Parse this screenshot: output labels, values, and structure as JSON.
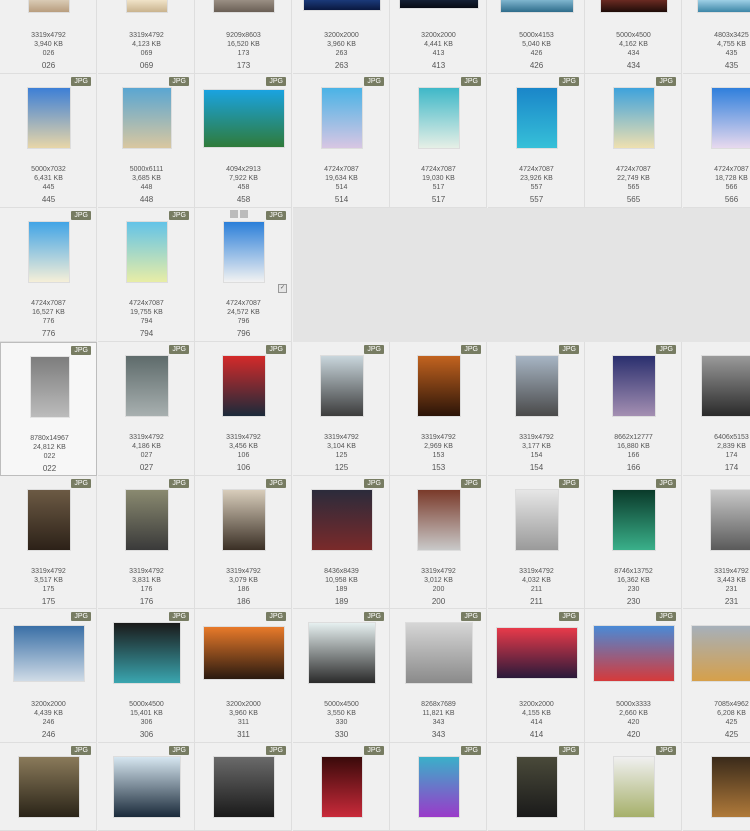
{
  "rows": [
    {
      "row": 0,
      "cells": [
        {
          "dim": "3319x4792",
          "size": "3,940 KB",
          "num": "026",
          "label": "026",
          "badge": "",
          "thumb": [
            "#d9cbb5",
            "#b89d7e"
          ]
        },
        {
          "dim": "3319x4792",
          "size": "4,123 KB",
          "num": "069",
          "label": "069",
          "badge": "",
          "thumb": [
            "#f0e3c8",
            "#c9b38e"
          ]
        },
        {
          "dim": "9209x8603",
          "size": "16,520 KB",
          "num": "173",
          "label": "173",
          "badge": "",
          "thumb": [
            "#9a8f84",
            "#6a5f55"
          ]
        },
        {
          "dim": "3200x2000",
          "size": "3,960 KB",
          "num": "263",
          "label": "263",
          "badge": "",
          "thumb": [
            "#1b3a7a",
            "#0a1840"
          ]
        },
        {
          "dim": "3200x2000",
          "size": "4,441 KB",
          "num": "413",
          "label": "413",
          "badge": "",
          "thumb": [
            "#152035",
            "#070b14"
          ]
        },
        {
          "dim": "5000x4153",
          "size": "5,040 KB",
          "num": "426",
          "label": "426",
          "badge": "",
          "thumb": [
            "#7fb6cf",
            "#2e6c8b"
          ]
        },
        {
          "dim": "5000x4500",
          "size": "4,162 KB",
          "num": "434",
          "label": "434",
          "badge": "",
          "thumb": [
            "#6a2a22",
            "#1f0c08"
          ]
        },
        {
          "dim": "4803x3425",
          "size": "4,755 KB",
          "num": "435",
          "label": "435",
          "badge": "",
          "thumb": [
            "#9ed0e6",
            "#3d86a7"
          ]
        }
      ]
    },
    {
      "row": 1,
      "cells": [
        {
          "dim": "5000x7032",
          "size": "6,431 KB",
          "num": "445",
          "label": "445",
          "badge": "JPG",
          "thumb": [
            "#3d7fd6",
            "#e8d6a8"
          ]
        },
        {
          "dim": "5000x6111",
          "size": "3,685 KB",
          "num": "448",
          "label": "448",
          "badge": "JPG",
          "thumb": [
            "#5aa6d2",
            "#d9c7a0"
          ]
        },
        {
          "dim": "4094x2913",
          "size": "7,922 KB",
          "num": "458",
          "label": "458",
          "badge": "JPG",
          "thumb": [
            "#1aa3e0",
            "#2f7b3a"
          ]
        },
        {
          "dim": "4724x7087",
          "size": "19,634 KB",
          "num": "514",
          "label": "514",
          "badge": "JPG",
          "thumb": [
            "#4ab3e6",
            "#d8c6e3"
          ]
        },
        {
          "dim": "4724x7087",
          "size": "19,030 KB",
          "num": "517",
          "label": "517",
          "badge": "JPG",
          "thumb": [
            "#3fb8c8",
            "#e6efe6"
          ]
        },
        {
          "dim": "4724x7087",
          "size": "23,926 KB",
          "num": "557",
          "label": "557",
          "badge": "JPG",
          "thumb": [
            "#1a86c9",
            "#36c0d8"
          ]
        },
        {
          "dim": "4724x7087",
          "size": "22,749 KB",
          "num": "565",
          "label": "565",
          "badge": "JPG",
          "thumb": [
            "#3ea2dc",
            "#efe0b0"
          ]
        },
        {
          "dim": "4724x7087",
          "size": "18,728 KB",
          "num": "566",
          "label": "566",
          "badge": "JPG",
          "thumb": [
            "#2f7fdc",
            "#e8d9ee"
          ]
        }
      ]
    },
    {
      "row": 2,
      "cells": [
        {
          "dim": "4724x7087",
          "size": "16,527 KB",
          "num": "776",
          "label": "776",
          "badge": "JPG",
          "thumb": [
            "#41a4e6",
            "#f6efd8"
          ]
        },
        {
          "dim": "4724x7087",
          "size": "19,755 KB",
          "num": "794",
          "label": "794",
          "badge": "JPG",
          "thumb": [
            "#63c3e8",
            "#e8eda6"
          ]
        },
        {
          "dim": "4724x7087",
          "size": "24,572 KB",
          "num": "796",
          "label": "796",
          "badge": "JPG",
          "thumb": [
            "#2b7fd9",
            "#f2f2f2"
          ]
        }
      ]
    },
    {
      "row": 3,
      "cells": [
        {
          "dim": "8780x14967",
          "size": "24,812 KB",
          "num": "022",
          "label": "022",
          "badge": "JPG",
          "thumb": [
            "#7d7d7d",
            "#bcbcbc"
          ]
        },
        {
          "dim": "3319x4792",
          "size": "4,186 KB",
          "num": "027",
          "label": "027",
          "badge": "JPG",
          "thumb": [
            "#5e6b6b",
            "#a8b0b0"
          ]
        },
        {
          "dim": "3319x4792",
          "size": "3,456 KB",
          "num": "106",
          "label": "106",
          "badge": "JPG",
          "thumb": [
            "#d42a2a",
            "#1b2a3a"
          ]
        },
        {
          "dim": "3319x4792",
          "size": "3,104 KB",
          "num": "125",
          "label": "125",
          "badge": "JPG",
          "thumb": [
            "#c9d6dc",
            "#3c3c3c"
          ]
        },
        {
          "dim": "3319x4792",
          "size": "2,969 KB",
          "num": "153",
          "label": "153",
          "badge": "JPG",
          "thumb": [
            "#c2631f",
            "#2b1408"
          ]
        },
        {
          "dim": "3319x4792",
          "size": "3,177 KB",
          "num": "154",
          "label": "154",
          "badge": "JPG",
          "thumb": [
            "#a7b5c4",
            "#4a4a4a"
          ]
        },
        {
          "dim": "8662x12777",
          "size": "16,880 KB",
          "num": "166",
          "label": "166",
          "badge": "JPG",
          "thumb": [
            "#2a2f6e",
            "#a48fb2"
          ]
        },
        {
          "dim": "6406x5153",
          "size": "2,839 KB",
          "num": "174",
          "label": "174",
          "badge": "JPG",
          "thumb": [
            "#9a9a9a",
            "#2a2a2a"
          ]
        }
      ]
    },
    {
      "row": 4,
      "cells": [
        {
          "dim": "3319x4792",
          "size": "3,517 KB",
          "num": "175",
          "label": "175",
          "badge": "JPG",
          "thumb": [
            "#6c5a44",
            "#2c2118"
          ]
        },
        {
          "dim": "3319x4792",
          "size": "3,831 KB",
          "num": "176",
          "label": "176",
          "badge": "JPG",
          "thumb": [
            "#8a8a70",
            "#3a3a3a"
          ]
        },
        {
          "dim": "3319x4792",
          "size": "3,079 KB",
          "num": "186",
          "label": "186",
          "badge": "JPG",
          "thumb": [
            "#d8cdbb",
            "#3a2f25"
          ]
        },
        {
          "dim": "8436x8439",
          "size": "10,958 KB",
          "num": "189",
          "label": "189",
          "badge": "JPG",
          "thumb": [
            "#2b2b3b",
            "#7a2a2a"
          ]
        },
        {
          "dim": "3319x4792",
          "size": "3,012 KB",
          "num": "200",
          "label": "200",
          "badge": "JPG",
          "thumb": [
            "#7a3a2a",
            "#c9c9c9"
          ]
        },
        {
          "dim": "3319x4792",
          "size": "4,032 KB",
          "num": "211",
          "label": "211",
          "badge": "JPG",
          "thumb": [
            "#e6e6e6",
            "#9a9a9a"
          ]
        },
        {
          "dim": "8746x13752",
          "size": "16,362 KB",
          "num": "230",
          "label": "230",
          "badge": "JPG",
          "thumb": [
            "#0a3a2a",
            "#3ab08a"
          ]
        },
        {
          "dim": "3319x4792",
          "size": "3,443 KB",
          "num": "231",
          "label": "231",
          "badge": "JPG",
          "thumb": [
            "#c8c8c8",
            "#5a5a5a"
          ]
        }
      ]
    },
    {
      "row": 5,
      "cells": [
        {
          "dim": "3200x2000",
          "size": "4,439 KB",
          "num": "246",
          "label": "246",
          "badge": "JPG",
          "thumb": [
            "#3a6fa6",
            "#cfdbe6"
          ]
        },
        {
          "dim": "5000x4500",
          "size": "15,401 KB",
          "num": "306",
          "label": "306",
          "badge": "JPG",
          "thumb": [
            "#1a1a1a",
            "#3aa6b0"
          ]
        },
        {
          "dim": "3200x2000",
          "size": "3,960 KB",
          "num": "311",
          "label": "311",
          "badge": "JPG",
          "thumb": [
            "#e87a2a",
            "#2a1a10"
          ]
        },
        {
          "dim": "5000x4500",
          "size": "3,550 KB",
          "num": "330",
          "label": "330",
          "badge": "JPG",
          "thumb": [
            "#e6f0f0",
            "#2a2a2a"
          ]
        },
        {
          "dim": "8268x7689",
          "size": "11,821 KB",
          "num": "343",
          "label": "343",
          "badge": "JPG",
          "thumb": [
            "#d6d6d6",
            "#8a8a8a"
          ]
        },
        {
          "dim": "3200x2000",
          "size": "4,155 KB",
          "num": "414",
          "label": "414",
          "badge": "JPG",
          "thumb": [
            "#e83a4a",
            "#2a1a3a"
          ]
        },
        {
          "dim": "5000x3333",
          "size": "2,660 KB",
          "num": "420",
          "label": "420",
          "badge": "JPG",
          "thumb": [
            "#4a8ad6",
            "#d63a3a"
          ]
        },
        {
          "dim": "7085x4962",
          "size": "6,208 KB",
          "num": "425",
          "label": "425",
          "badge": "JPG",
          "thumb": [
            "#a6b0ba",
            "#d6a04a"
          ]
        }
      ]
    },
    {
      "row": 6,
      "cells": [
        {
          "dim": "",
          "size": "",
          "num": "",
          "label": "",
          "badge": "JPG",
          "thumb": [
            "#8a7a5a",
            "#2a2418"
          ]
        },
        {
          "dim": "",
          "size": "",
          "num": "",
          "label": "",
          "badge": "JPG",
          "thumb": [
            "#d6e6f0",
            "#1a2a3a"
          ]
        },
        {
          "dim": "",
          "size": "",
          "num": "",
          "label": "",
          "badge": "JPG",
          "thumb": [
            "#6a6a6a",
            "#1a1a1a"
          ]
        },
        {
          "dim": "",
          "size": "",
          "num": "",
          "label": "",
          "badge": "JPG",
          "thumb": [
            "#3a0a0a",
            "#c92a3a"
          ]
        },
        {
          "dim": "",
          "size": "",
          "num": "",
          "label": "",
          "badge": "JPG",
          "thumb": [
            "#3ab0c9",
            "#9a3ac9"
          ]
        },
        {
          "dim": "",
          "size": "",
          "num": "",
          "label": "",
          "badge": "JPG",
          "thumb": [
            "#4a4a3a",
            "#1a1a1a"
          ]
        },
        {
          "dim": "",
          "size": "",
          "num": "",
          "label": "",
          "badge": "JPG",
          "thumb": [
            "#f0f0f0",
            "#a6b06a"
          ]
        },
        {
          "dim": "",
          "size": "",
          "num": "",
          "label": "",
          "badge": "JPG",
          "thumb": [
            "#3a2a1a",
            "#b07a3a"
          ]
        }
      ]
    }
  ]
}
